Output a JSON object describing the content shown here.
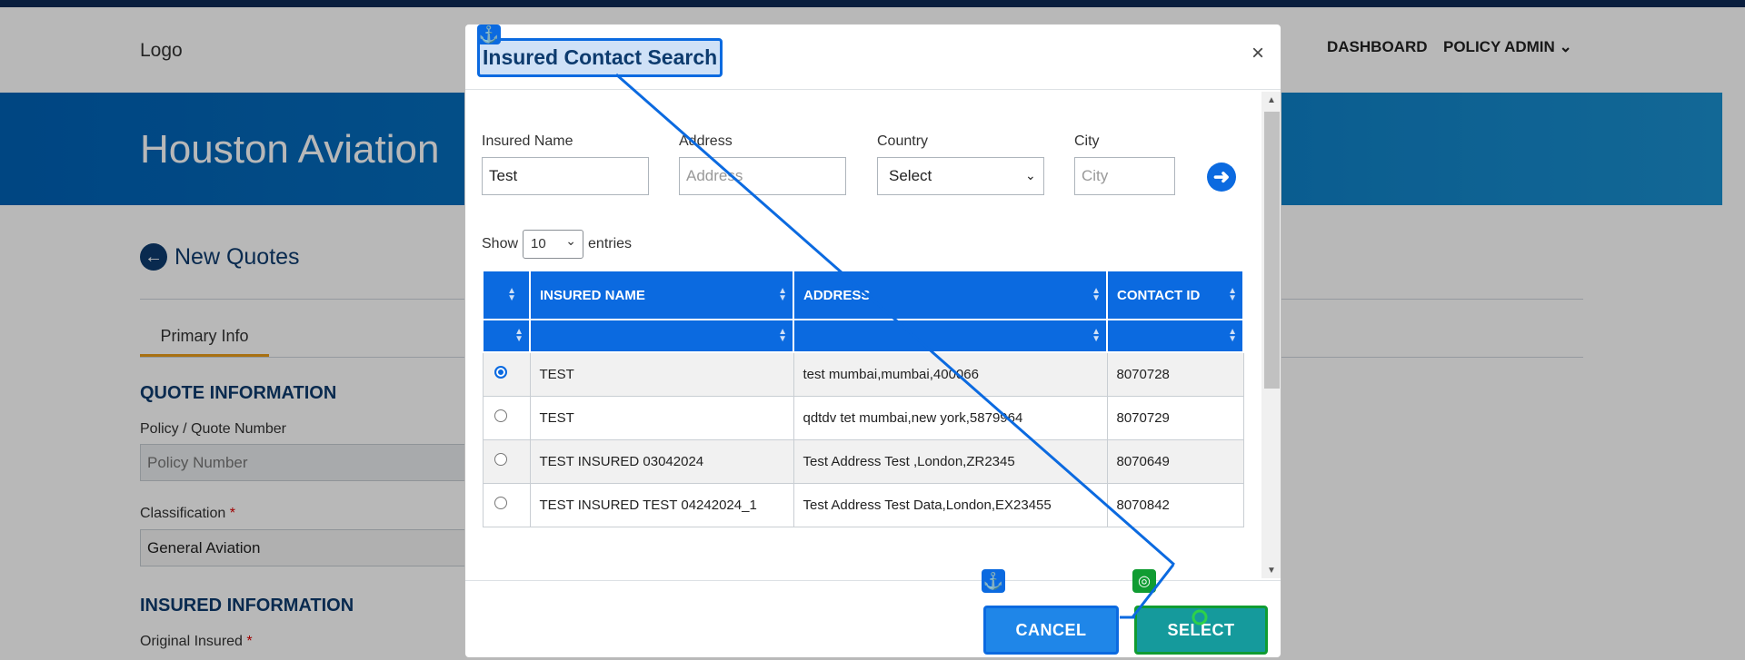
{
  "header": {
    "logo_alt": "Logo",
    "nav": [
      "DASHBOARD",
      "POLICY ADMIN"
    ]
  },
  "hero": {
    "title": "Houston Aviation"
  },
  "page": {
    "back_label": "New Quotes",
    "tab": "Primary Info",
    "quote_section": "QUOTE INFORMATION",
    "policy_label": "Policy / Quote Number",
    "policy_placeholder": "Policy Number",
    "classification_label": "Classification",
    "classification_value": "General Aviation",
    "insured_section": "INSURED INFORMATION",
    "original_insured_label": "Original Insured",
    "required_mark": "*"
  },
  "modal": {
    "title": "Insured Contact Search",
    "close": "×",
    "filters": {
      "insured_name_label": "Insured Name",
      "insured_name_value": "Test",
      "address_label": "Address",
      "address_placeholder": "Address",
      "country_label": "Country",
      "country_value": "Select",
      "city_label": "City",
      "city_placeholder": "City"
    },
    "show_label": "Show",
    "entries_value": "10",
    "entries_label": "entries",
    "columns": [
      "INSURED NAME",
      "ADDRESS",
      "CONTACT ID"
    ],
    "rows": [
      {
        "name": "TEST",
        "address": "test mumbai,mumbai,400066",
        "contact_id": "8070728",
        "selected": true
      },
      {
        "name": "TEST",
        "address": "qdtdv tet mumbai,new york,5879964",
        "contact_id": "8070729",
        "selected": false
      },
      {
        "name": "TEST INSURED 03042024",
        "address": "Test Address Test ,London,ZR2345",
        "contact_id": "8070649",
        "selected": false
      },
      {
        "name": "TEST INSURED TEST 04242024_1",
        "address": "Test Address Test Data,London,EX23455",
        "contact_id": "8070842",
        "selected": false
      }
    ],
    "cancel_label": "CANCEL",
    "select_label": "SELECT"
  },
  "colors": {
    "primary": "#0b6ae0",
    "navy": "#0d3b6e",
    "accent": "#e99b1a",
    "select_button": "#159a9c"
  },
  "icons": [
    "anchor-icon",
    "target-icon",
    "arrow-right-circle-icon",
    "arrow-left-circle-icon",
    "chevron-down-icon",
    "sort-icon",
    "close-icon"
  ]
}
